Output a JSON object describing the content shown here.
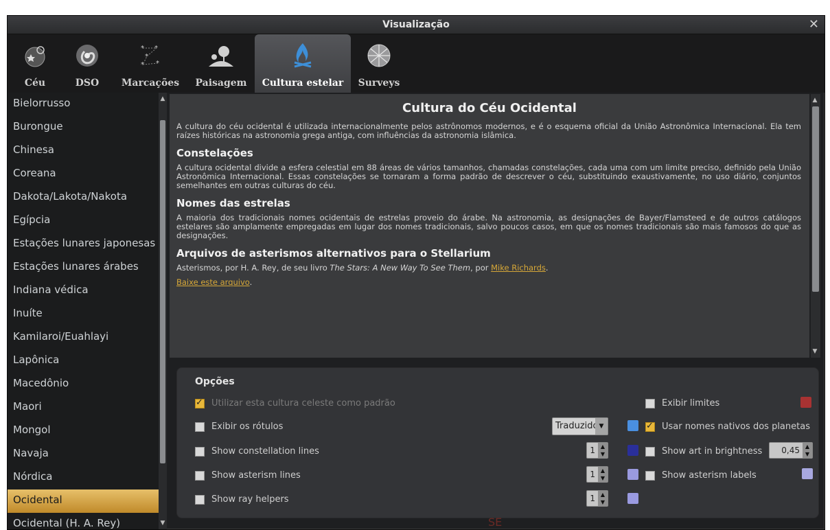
{
  "window": {
    "title": "Visualização",
    "close_icon": "close-icon"
  },
  "tabs": [
    {
      "label": "Céu",
      "icon": "sky-icon"
    },
    {
      "label": "DSO",
      "icon": "galaxy-icon"
    },
    {
      "label": "Marcações",
      "icon": "markings-icon"
    },
    {
      "label": "Paisagem",
      "icon": "landscape-icon"
    },
    {
      "label": "Cultura estelar",
      "icon": "campfire-icon",
      "active": true
    },
    {
      "label": "Surveys",
      "icon": "globe-icon"
    }
  ],
  "sidebar": {
    "items": [
      "Bielorrusso",
      "Burongue",
      "Chinesa",
      "Coreana",
      "Dakota/Lakota/Nakota",
      "Egípcia",
      "Estações lunares japonesas",
      "Estações lunares árabes",
      "Indiana védica",
      "Inuíte",
      "Kamilaroi/Euahlayi",
      "Lapônica",
      "Macedônio",
      "Maori",
      "Mongol",
      "Navaja",
      "Nórdica",
      "Ocidental",
      "Ocidental (H. A. Rey)"
    ],
    "selected": "Ocidental"
  },
  "content": {
    "title": "Cultura do Céu Ocidental",
    "intro": "A cultura do céu ocidental é utilizada internacionalmente pelos astrônomos modernos, e é o esquema oficial da União Astronômica Internacional. Ela tem raízes históricas na astronomia grega antiga, com influências da astronomia islâmica.",
    "sec1_title": "Constelações",
    "sec1_text": "A cultura ocidental divide a esfera celestial em 88 áreas de vários tamanhos, chamadas constelações, cada uma com um limite preciso, definido pela União Astronômica Internacional. Essas constelações se tornaram a forma padrão de descrever o céu, substituindo exaustivamente, no uso diário, conjuntos semelhantes em outras culturas do céu.",
    "sec2_title": "Nomes das estrelas",
    "sec2_text": "A maioria dos tradicionais nomes ocidentais de estrelas proveio do árabe. Na astronomia, as designações de Bayer/Flamsteed e de outros catálogos estelares são amplamente empregadas em lugar dos nomes tradicionais, salvo poucos casos, em que os nomes tradicionais são mais famosos do que as designações.",
    "sec3_title": "Arquivos de asterismos alternativos para o Stellarium",
    "sec3_text_prefix": "Asterismos, por H. A. Rey, de seu livro ",
    "sec3_book": "The Stars: A New Way To See Them",
    "sec3_text_mid": ", por ",
    "sec3_author_link": "Mike Richards",
    "sec3_text_end": ".",
    "download_link": "Baixe este arquivo",
    "download_end": "."
  },
  "options": {
    "heading": "Opções",
    "use_default": {
      "label": "Utilizar esta cultura celeste como padrão",
      "checked": true
    },
    "show_labels": {
      "label": "Exibir os rótulos",
      "checked": false
    },
    "labels_mode": "Traduzidos",
    "show_const_lines": {
      "label": "Show constellation lines",
      "checked": false,
      "value": "1"
    },
    "show_asterism_lines": {
      "label": "Show asterism lines",
      "checked": false,
      "value": "1"
    },
    "show_ray_helpers": {
      "label": "Show ray helpers",
      "checked": false,
      "value": "1"
    },
    "show_limits": {
      "label": "Exibir limites",
      "checked": false
    },
    "native_planet_names": {
      "label": "Usar nomes nativos dos planetas",
      "checked": true
    },
    "show_art": {
      "label": "Show art in brightness",
      "checked": false,
      "value": "0,45"
    },
    "show_asterism_labels": {
      "label": "Show asterism labels",
      "checked": false
    },
    "colors": {
      "limits": "#a83232",
      "labels": "#4a8fe0",
      "const_lines": "#2a2f9a",
      "asterism_lines": "#9a9ae0",
      "ray_helpers": "#9a9ae0",
      "asterism_labels": "#a8a8e0"
    }
  },
  "footer_text": "SE"
}
